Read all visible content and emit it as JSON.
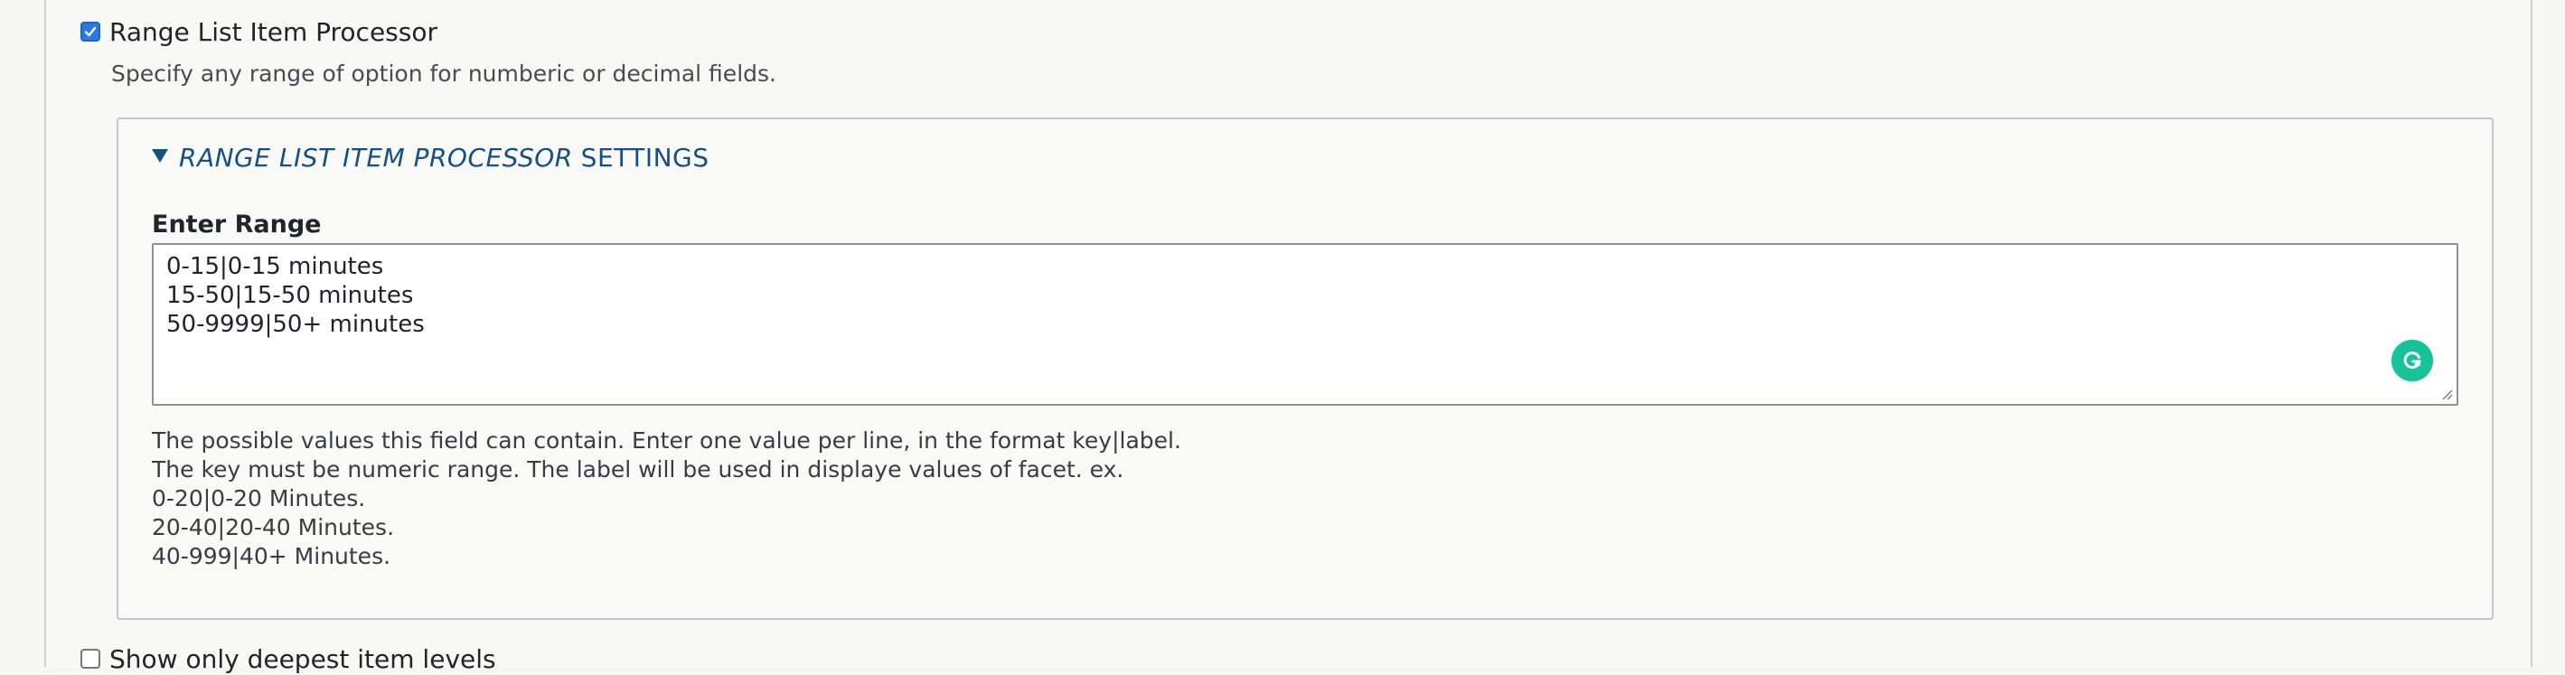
{
  "range_processor": {
    "label": "Range List Item Processor",
    "checked": true,
    "description": "Specify any range of option for numberic or decimal fields.",
    "settings": {
      "summary_italic": "RANGE LIST ITEM PROCESSOR",
      "summary_regular": "SETTINGS",
      "field_label": "Enter Range",
      "textarea_lines": [
        "0-15|0-15 minutes",
        "15-50|15-50 minutes",
        "50-9999|50+ minutes"
      ],
      "help_lines": [
        "The possible values this field can contain. Enter one value per line, in the format key|label.",
        "The key must be numeric range. The label will be used in displaye values of facet. ex.",
        "0-20|0-20 Minutes.",
        "20-40|20-40 Minutes.",
        "40-999|40+ Minutes."
      ]
    }
  },
  "deepest_levels": {
    "label": "Show only deepest item levels",
    "checked": false
  },
  "icons": {
    "summary_toggle": "triangle-down-icon",
    "grammarly": "grammarly-icon",
    "resize": "resize-handle-icon"
  },
  "colors": {
    "accent": "#2a7ae2",
    "link": "#154f84",
    "grammarly": "#15c39a"
  }
}
